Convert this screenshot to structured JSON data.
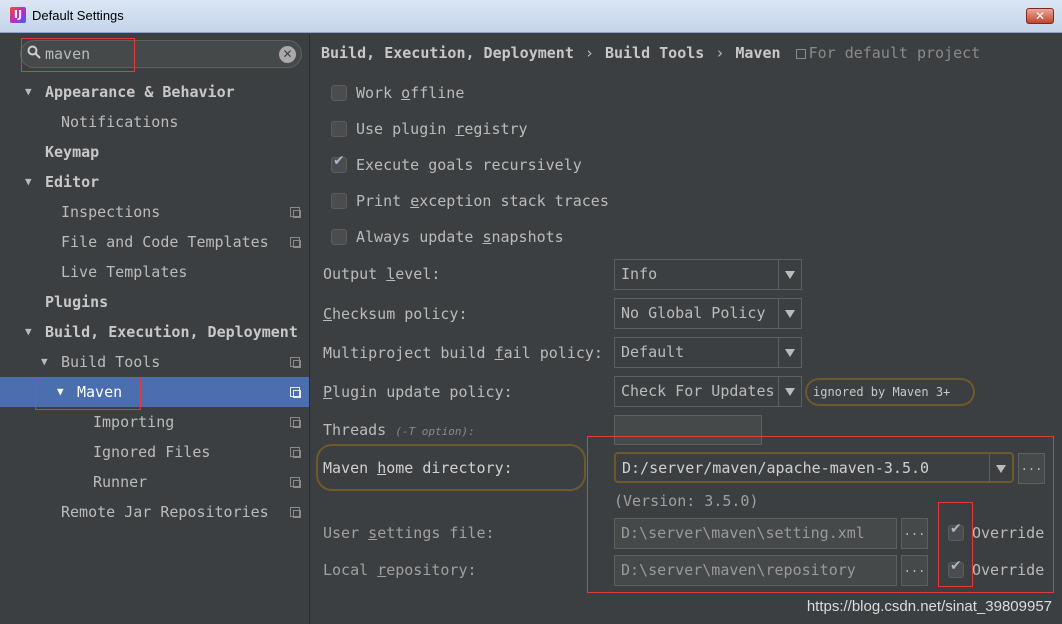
{
  "window": {
    "title": "Default Settings",
    "close_label": "✕"
  },
  "search": {
    "value": "maven",
    "placeholder": ""
  },
  "sidebar": {
    "items": [
      {
        "label": "Appearance & Behavior"
      },
      {
        "label": "Notifications"
      },
      {
        "label": "Keymap"
      },
      {
        "label": "Editor"
      },
      {
        "label": "Inspections"
      },
      {
        "label": "File and Code Templates"
      },
      {
        "label": "Live Templates"
      },
      {
        "label": "Plugins"
      },
      {
        "label": "Build, Execution, Deployment"
      },
      {
        "label": "Build Tools"
      },
      {
        "label": "Maven"
      },
      {
        "label": "Importing"
      },
      {
        "label": "Ignored Files"
      },
      {
        "label": "Runner"
      },
      {
        "label": "Remote Jar Repositories"
      }
    ]
  },
  "breadcrumb": {
    "parts": [
      "Build, Execution, Deployment",
      "Build Tools",
      "Maven"
    ],
    "separator": "›",
    "scope": "For default project"
  },
  "checkboxes": [
    {
      "pre": "Work ",
      "u": "o",
      "post": "ffline",
      "checked": false
    },
    {
      "pre": "Use plugin ",
      "u": "r",
      "post": "egistry",
      "checked": false
    },
    {
      "pre": "Execute ",
      "u": "g",
      "post": "oals recursively",
      "checked": true
    },
    {
      "pre": "Print ",
      "u": "e",
      "post": "xception stack traces",
      "checked": false
    },
    {
      "pre": "Always update ",
      "u": "s",
      "post": "napshots",
      "checked": false
    }
  ],
  "fields": {
    "output_level": {
      "pre": "Output ",
      "u": "l",
      "post": "evel:",
      "value": "Info"
    },
    "checksum_policy": {
      "pre": "",
      "u": "C",
      "post": "hecksum policy:",
      "value": "No Global Policy"
    },
    "fail_policy": {
      "pre": "Multiproject build ",
      "u": "f",
      "post": "ail policy:",
      "value": "Default"
    },
    "plugin_update": {
      "pre": "",
      "u": "P",
      "post": "lugin update policy:",
      "value": "Check For Updates",
      "note": "ignored by Maven 3+"
    },
    "threads": {
      "label": "Threads",
      "hint": "(-T option):",
      "value": ""
    },
    "maven_home": {
      "pre": "Maven ",
      "u": "h",
      "post": "ome directory:",
      "value": "D:/server/maven/apache-maven-3.5.0",
      "version": "(Version: 3.5.0)"
    },
    "user_settings": {
      "pre": "User ",
      "u": "s",
      "post": "ettings file:",
      "value": "D:\\server\\maven\\setting.xml",
      "override": "Override",
      "override_checked": true
    },
    "local_repo": {
      "pre": "Local ",
      "u": "r",
      "post": "epository:",
      "value": "D:\\server\\maven\\repository",
      "override": "Override",
      "override_checked": true
    }
  },
  "browse_label": "...",
  "watermark": "https://blog.csdn.net/sinat_39809957"
}
